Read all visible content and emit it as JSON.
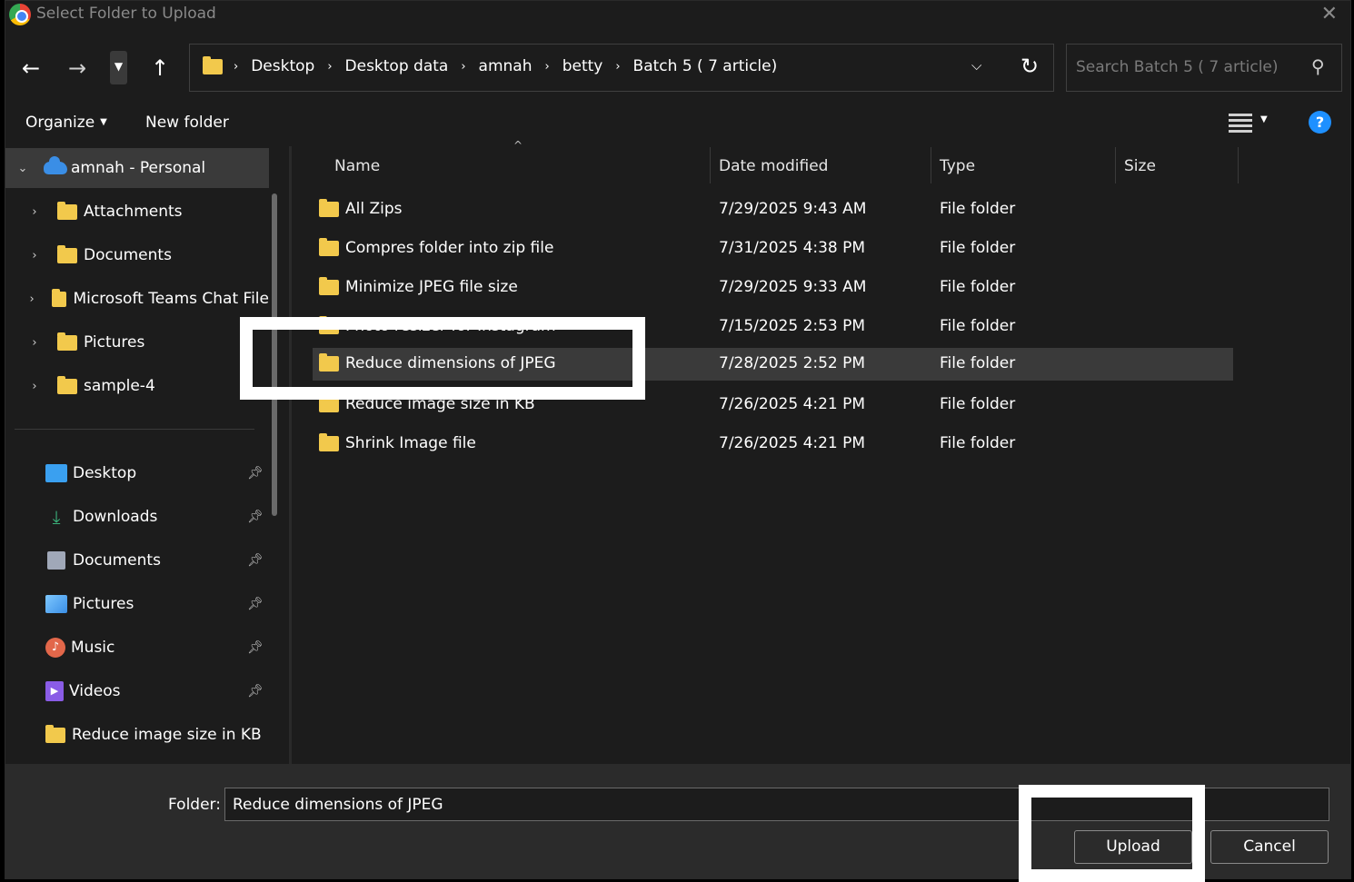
{
  "window": {
    "title": "Select Folder to Upload"
  },
  "address": {
    "crumbs": [
      "Desktop",
      "Desktop data",
      "amnah",
      "betty",
      "Batch 5 ( 7 article)"
    ],
    "search_placeholder": "Search Batch 5 ( 7 article)"
  },
  "toolbar": {
    "organize": "Organize",
    "new_folder": "New folder"
  },
  "tree": {
    "root": "amnah - Personal",
    "items": [
      "Attachments",
      "Documents",
      "Microsoft Teams Chat File",
      "Pictures",
      "sample-4"
    ]
  },
  "quick_access": [
    {
      "label": "Desktop",
      "icon": "desktop-icon",
      "color": "#3aa0f0"
    },
    {
      "label": "Downloads",
      "icon": "download-icon",
      "color": "#3ab07a"
    },
    {
      "label": "Documents",
      "icon": "document-icon",
      "color": "#a0a8b8"
    },
    {
      "label": "Pictures",
      "icon": "picture-icon",
      "color": "#3a8ee6"
    },
    {
      "label": "Music",
      "icon": "music-icon",
      "color": "#e2674a"
    },
    {
      "label": "Videos",
      "icon": "video-icon",
      "color": "#8a5ce6"
    },
    {
      "label": "Reduce image size in KB",
      "icon": "folder-icon",
      "color": "#f2c94c"
    }
  ],
  "columns": {
    "name": "Name",
    "date": "Date modified",
    "type": "Type",
    "size": "Size"
  },
  "files": [
    {
      "name": "All Zips",
      "date": "7/29/2025 9:43 AM",
      "type": "File folder"
    },
    {
      "name": "Compres folder into zip file",
      "date": "7/31/2025 4:38 PM",
      "type": "File folder"
    },
    {
      "name": "Minimize JPEG file size",
      "date": "7/29/2025 9:33 AM",
      "type": "File folder"
    },
    {
      "name": "Photo resizer for Instagram",
      "date": "7/15/2025 2:53 PM",
      "type": "File folder"
    },
    {
      "name": "Reduce dimensions of JPEG",
      "date": "7/28/2025 2:52 PM",
      "type": "File folder"
    },
    {
      "name": "Reduce image size in KB",
      "date": "7/26/2025 4:21 PM",
      "type": "File folder"
    },
    {
      "name": "Shrink Image file",
      "date": "7/26/2025 4:21 PM",
      "type": "File folder"
    }
  ],
  "footer": {
    "folder_label": "Folder:",
    "folder_value": "Reduce dimensions of JPEG",
    "upload": "Upload",
    "cancel": "Cancel"
  }
}
